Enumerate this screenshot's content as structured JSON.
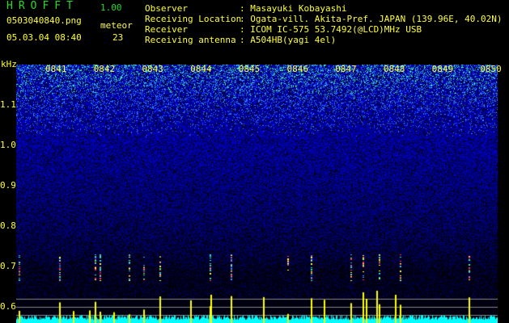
{
  "app": {
    "logo": "HROFFT",
    "version": "1.00"
  },
  "file": {
    "name": "0503040840.png",
    "datetime": "05.03.04 08:40"
  },
  "meteor": {
    "label": "meteor",
    "count": "23"
  },
  "info": [
    {
      "label": "Observer",
      "value": ": Masayuki Kobayashi"
    },
    {
      "label": "Receiving Location",
      "value": ": Ogata-vill. Akita-Pref. JAPAN (139.96E, 40.02N)"
    },
    {
      "label": "Receiver",
      "value": ": ICOM IC-575 53.7492(@LCD)MHz USB"
    },
    {
      "label": "Receiving antenna",
      "value": ": A504HB(yagi 4el)"
    }
  ],
  "axis": {
    "unit": "kHz",
    "time_labels": [
      "0841",
      "0842",
      "0843",
      "0844",
      "0845",
      "0846",
      "0847",
      "0848",
      "0849",
      "0850"
    ],
    "freq_labels": [
      "1.1",
      "1.0",
      "0.9",
      "0.8",
      "0.7",
      "0.6"
    ]
  },
  "colors": {
    "text": "#ffff33",
    "logo": "#22dd22",
    "echo_bar": "#ffff00",
    "noise_floor": "#00ffff"
  }
}
